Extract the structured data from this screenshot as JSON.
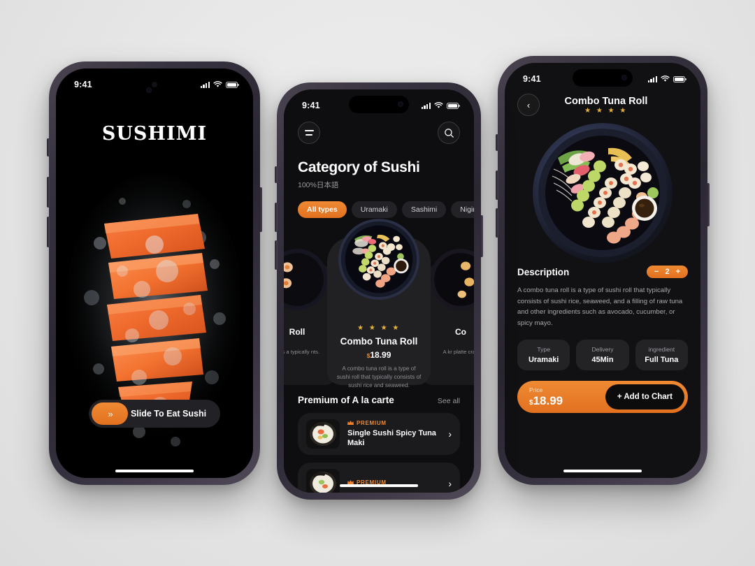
{
  "accent": "#ee7f2d",
  "splash": {
    "status": {
      "time": "9:41"
    },
    "brand": "SUSHIMI",
    "slide_label": "Slide To Eat Sushi",
    "slide_chevrons": "»"
  },
  "category": {
    "status": {
      "time": "9:41"
    },
    "menu_icon": "menu-icon",
    "search_icon": "search-icon",
    "title": "Category of Sushi",
    "subtitle": "100%日本語",
    "chips": [
      {
        "label": "All types",
        "active": true
      },
      {
        "label": "Uramaki",
        "active": false
      },
      {
        "label": "Sashimi",
        "active": false
      },
      {
        "label": "Nigiri",
        "active": false
      }
    ],
    "carousel": {
      "left": {
        "title": "Roll",
        "desc": "er is a typically nts."
      },
      "center": {
        "stars": "★ ★ ★ ★",
        "title": "Combo Tuna Roll",
        "currency": "$",
        "price": "18.99",
        "desc": "A combo tuna roll is a type of sushi roll that typically consists of sushi rice and seaweed."
      },
      "right": {
        "title": "Co",
        "desc": "A kr platte crab"
      }
    },
    "premium_section": {
      "title": "Premium of A la carte",
      "see_all": "See all",
      "items": [
        {
          "badge": "PREMIUM",
          "name": "Single Sushi Spicy Tuna Maki",
          "chevron": "›"
        },
        {
          "badge": "PREMIUM",
          "name": "",
          "chevron": "›"
        }
      ]
    }
  },
  "detail": {
    "status": {
      "time": "9:41"
    },
    "back_icon": "chevron-left-icon",
    "title": "Combo Tuna Roll",
    "stars": "★ ★ ★ ★",
    "description_heading": "Description",
    "quantity": {
      "minus": "−",
      "value": "2",
      "plus": "+"
    },
    "description": "A combo tuna roll is a type of sushi roll that typically consists of sushi rice, seaweed, and a filling of raw tuna and other ingredients such as avocado, cucumber, or spicy mayo.",
    "info": [
      {
        "key": "Type",
        "value": "Uramaki"
      },
      {
        "key": "Delivery",
        "value": "45Min"
      },
      {
        "key": "ingredient",
        "value": "Full Tuna"
      }
    ],
    "cta": {
      "price_label": "Price",
      "currency": "$",
      "price": "18.99",
      "button": "+ Add to Chart"
    }
  }
}
